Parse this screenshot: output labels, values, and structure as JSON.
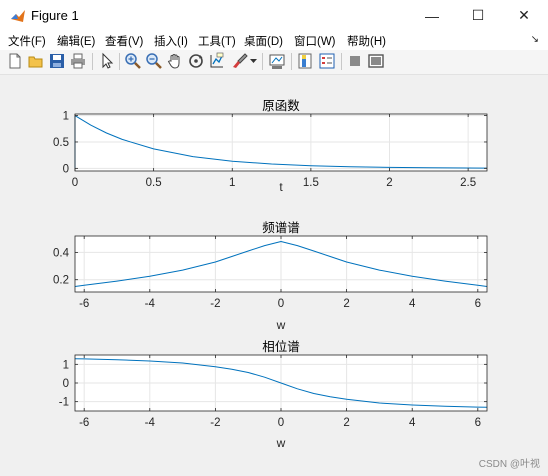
{
  "window": {
    "title": "Figure 1",
    "minimize_glyph": "—",
    "maximize_glyph": "☐",
    "close_glyph": "✕"
  },
  "menu": {
    "items": [
      {
        "label": "文件(F)"
      },
      {
        "label": "编辑(E)"
      },
      {
        "label": "查看(V)"
      },
      {
        "label": "插入(I)"
      },
      {
        "label": "工具(T)"
      },
      {
        "label": "桌面(D)"
      },
      {
        "label": "窗口(W)"
      },
      {
        "label": "帮助(H)"
      }
    ],
    "pin_glyph": "↘"
  },
  "toolbar": {
    "icons": [
      "new-figure-icon",
      "open-file-icon",
      "save-icon",
      "print-icon",
      "select-arrow-icon",
      "zoom-in-icon",
      "zoom-out-icon",
      "pan-hand-icon",
      "rotate-3d-icon",
      "data-cursor-icon",
      "brush-icon",
      "brush-dropdown-icon",
      "link-plot-icon",
      "colorbar-icon",
      "legend-icon",
      "hide-plot-tools-icon",
      "show-plot-tools-icon"
    ]
  },
  "watermark": "CSDN @叶视",
  "colors": {
    "line": "#0072bd",
    "axes_bg": "#ffffff",
    "figure_bg": "#f0f0f0",
    "grid": "#e6e6e6",
    "axis": "#262626"
  },
  "chart_data": [
    {
      "type": "line",
      "title": "原函数",
      "xlabel": "t",
      "ylabel": "",
      "xlim": [
        0,
        2.62
      ],
      "ylim": [
        -0.05,
        1.03
      ],
      "xticks": [
        0,
        0.5,
        1,
        1.5,
        2,
        2.5
      ],
      "xtick_labels": [
        "0",
        "0.5",
        "1",
        "1.5",
        "2",
        "2.5"
      ],
      "yticks": [
        0,
        0.5,
        1
      ],
      "ytick_labels": [
        "0",
        "0.5",
        "1"
      ],
      "grid": true,
      "series": [
        {
          "x": [
            0,
            0,
            0.01,
            0.1,
            0.2,
            0.3,
            0.5,
            0.75,
            1.0,
            1.25,
            1.5,
            1.75,
            2.0,
            2.25,
            2.5,
            2.62
          ],
          "y": [
            0,
            1,
            0.98,
            0.819,
            0.67,
            0.549,
            0.368,
            0.223,
            0.135,
            0.082,
            0.05,
            0.03,
            0.018,
            0.011,
            0.007,
            0.005
          ]
        }
      ]
    },
    {
      "type": "line",
      "title": "频谱谱",
      "xlabel": "w",
      "ylabel": "",
      "xlim": [
        -6.28,
        6.28
      ],
      "ylim": [
        0.11,
        0.52
      ],
      "xticks": [
        -6,
        -4,
        -2,
        0,
        2,
        4,
        6
      ],
      "xtick_labels": [
        "-6",
        "-4",
        "-2",
        "0",
        "2",
        "4",
        "6"
      ],
      "yticks": [
        0.2,
        0.4
      ],
      "ytick_labels": [
        "0.2",
        "0.4"
      ],
      "grid": true,
      "series": [
        {
          "x": [
            -6.28,
            -6,
            -5,
            -4,
            -3,
            -2,
            -1.5,
            -1,
            -0.5,
            0,
            0.5,
            1,
            1.5,
            2,
            3,
            4,
            5,
            6,
            6.28
          ],
          "y": [
            0.15,
            0.16,
            0.19,
            0.225,
            0.27,
            0.33,
            0.37,
            0.41,
            0.45,
            0.48,
            0.45,
            0.41,
            0.37,
            0.33,
            0.27,
            0.225,
            0.19,
            0.16,
            0.15
          ]
        }
      ]
    },
    {
      "type": "line",
      "title": "相位谱",
      "xlabel": "w",
      "ylabel": "",
      "xlim": [
        -6.28,
        6.28
      ],
      "ylim": [
        -1.5,
        1.5
      ],
      "xticks": [
        -6,
        -4,
        -2,
        0,
        2,
        4,
        6
      ],
      "xtick_labels": [
        "-6",
        "-4",
        "-2",
        "0",
        "2",
        "4",
        "6"
      ],
      "yticks": [
        -1,
        0,
        1
      ],
      "ytick_labels": [
        "-1",
        "0",
        "1"
      ],
      "grid": true,
      "series": [
        {
          "x": [
            -6.28,
            -6,
            -5,
            -4,
            -3,
            -2,
            -1.5,
            -1,
            -0.5,
            0,
            0.5,
            1,
            1.5,
            2,
            3,
            4,
            5,
            6,
            6.28
          ],
          "y": [
            1.3,
            1.29,
            1.25,
            1.18,
            1.07,
            0.87,
            0.74,
            0.56,
            0.31,
            0,
            -0.31,
            -0.56,
            -0.74,
            -0.87,
            -1.07,
            -1.18,
            -1.25,
            -1.29,
            -1.3
          ]
        }
      ]
    }
  ]
}
